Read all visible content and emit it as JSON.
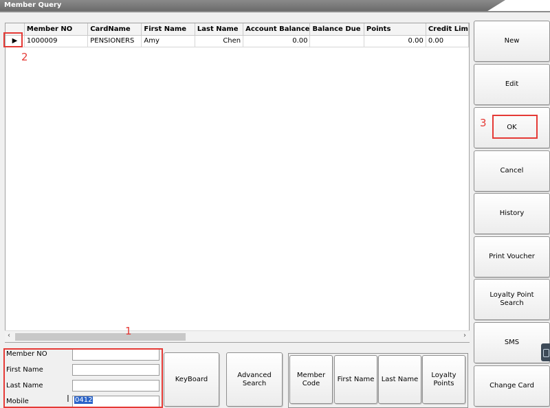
{
  "window": {
    "title": "Member Query"
  },
  "grid": {
    "columns": [
      "Member NO",
      "CardName",
      "First Name",
      "Last Name",
      "Account Balance",
      "Balance Due",
      "Points",
      "Credit Lim"
    ],
    "rows": [
      {
        "member_no": "1000009",
        "card_name": "PENSIONERS",
        "first_name": "Amy",
        "last_name": "Chen",
        "account_balance": "0.00",
        "balance_due": "",
        "points": "0.00",
        "credit_limit": "0.00"
      }
    ]
  },
  "search": {
    "member_no_label": "Member NO",
    "first_name_label": "First Name",
    "last_name_label": "Last Name",
    "mobile_label": "Mobile",
    "member_no_value": "",
    "first_name_value": "",
    "last_name_value": "",
    "mobile_value": "0412"
  },
  "bottom_buttons": {
    "keyboard": "KeyBoard",
    "advanced_search": "Advanced\nSearch",
    "member_code": "Member\nCode",
    "first_name": "First Name",
    "last_name": "Last Name",
    "loyalty_points": "Loyalty\nPoints"
  },
  "side_buttons": {
    "new": "New",
    "edit": "Edit",
    "ok": "OK",
    "cancel": "Cancel",
    "history": "History",
    "print_voucher": "Print Voucher",
    "loyalty_point_search": "Loyalty Point\nSearch",
    "sms": "SMS",
    "change_card": "Change Card"
  },
  "annotations": {
    "one": "1",
    "two": "2",
    "three": "3"
  },
  "colors": {
    "annotation": "#e53935",
    "selection": "#2a63c9"
  }
}
